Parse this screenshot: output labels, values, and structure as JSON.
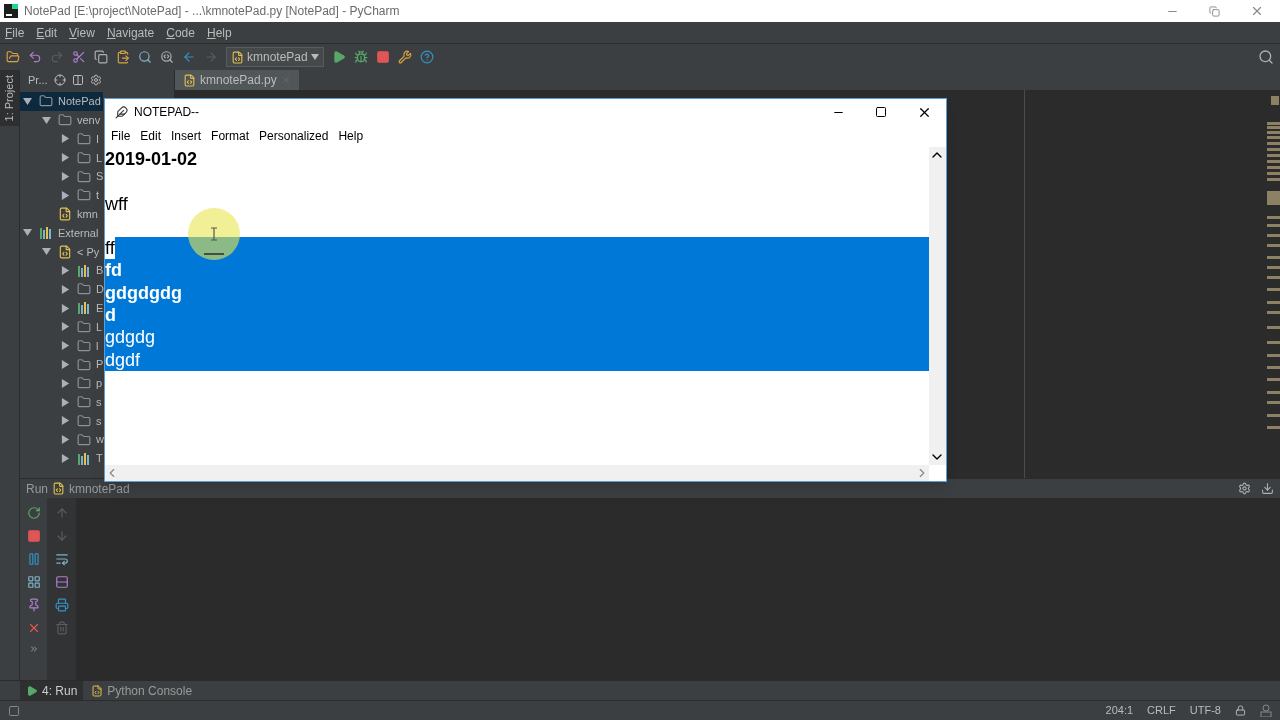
{
  "window": {
    "title": "NotePad [E:\\project\\NotePad] - ...\\kmnotePad.py [NotePad] - PyCharm"
  },
  "menu": [
    "File",
    "Edit",
    "View",
    "Navigate",
    "Code",
    "Help"
  ],
  "toolbar": {
    "run_config": "kmnotePad"
  },
  "side_strip": {
    "label": "1: Project"
  },
  "project_panel": {
    "header": "Pr...",
    "tree": [
      {
        "name": "NotePad",
        "kind": "folder",
        "expanded": true,
        "selected": true,
        "children": [
          {
            "name": "venv",
            "kind": "folder",
            "expanded": true,
            "selected": false,
            "children": [
              {
                "name": "I",
                "kind": "folder",
                "expanded": false,
                "selected": false
              },
              {
                "name": "L",
                "kind": "folder",
                "expanded": false,
                "selected": false
              },
              {
                "name": "S",
                "kind": "folder",
                "expanded": false,
                "selected": false
              },
              {
                "name": "t",
                "kind": "folder",
                "expanded": false,
                "selected": false
              }
            ]
          },
          {
            "name": "kmn",
            "kind": "python",
            "selected": false
          }
        ]
      },
      {
        "name": "External",
        "kind": "library",
        "expanded": true,
        "selected": false,
        "children": [
          {
            "name": "< Py",
            "kind": "python",
            "expanded": true,
            "selected": false,
            "children": [
              {
                "name": "B",
                "kind": "library",
                "expanded": false,
                "selected": false
              },
              {
                "name": "D",
                "kind": "folder",
                "expanded": false,
                "selected": false
              },
              {
                "name": "E",
                "kind": "library",
                "expanded": false,
                "selected": false
              },
              {
                "name": "L",
                "kind": "folder",
                "expanded": false,
                "selected": false
              },
              {
                "name": "l",
                "kind": "folder",
                "expanded": false,
                "selected": false
              },
              {
                "name": "P",
                "kind": "folder",
                "expanded": false,
                "selected": false
              },
              {
                "name": "p",
                "kind": "folder",
                "expanded": false,
                "selected": false
              },
              {
                "name": "s",
                "kind": "folder",
                "expanded": false,
                "selected": false
              },
              {
                "name": "s",
                "kind": "folder",
                "expanded": false,
                "selected": false
              },
              {
                "name": "w",
                "kind": "folder",
                "expanded": false,
                "selected": false
              },
              {
                "name": "T",
                "kind": "library",
                "expanded": false,
                "selected": false
              }
            ]
          }
        ]
      }
    ]
  },
  "editor": {
    "tabs": [
      {
        "label": "kmnotePad.py",
        "selected": true
      }
    ]
  },
  "run_panel": {
    "title": "Run",
    "config": "kmnotePad"
  },
  "bottom_tabs": [
    {
      "label": "4: Run",
      "selected": true
    },
    {
      "label": "Python Console",
      "selected": false
    }
  ],
  "status_bar": {
    "position": "204:1",
    "line_separator": "CRLF",
    "encoding": "UTF-8"
  },
  "notepad": {
    "title": "NOTEPAD--",
    "menu": [
      "File",
      "Edit",
      "Insert",
      "Format",
      "Personalized",
      "Help"
    ],
    "lines": [
      {
        "kind": "text",
        "text": "2019-01-02",
        "bold": true,
        "selected": false
      },
      {
        "kind": "blank"
      },
      {
        "kind": "text",
        "text": "wff",
        "bold": false,
        "selected": false
      },
      {
        "kind": "blank"
      },
      {
        "kind": "text",
        "text": "ff",
        "bold": false,
        "selected": false,
        "selection_tail": true
      },
      {
        "kind": "text",
        "text": "fd",
        "bold": true,
        "selected": true
      },
      {
        "kind": "text",
        "text": "gdgdgdg",
        "bold": true,
        "selected": true
      },
      {
        "kind": "text",
        "text": "d",
        "bold": true,
        "selected": true
      },
      {
        "kind": "text",
        "text": "gdgdg",
        "bold": false,
        "selected": true
      },
      {
        "kind": "text",
        "text": "dgdf",
        "bold": false,
        "selected": true
      }
    ]
  }
}
